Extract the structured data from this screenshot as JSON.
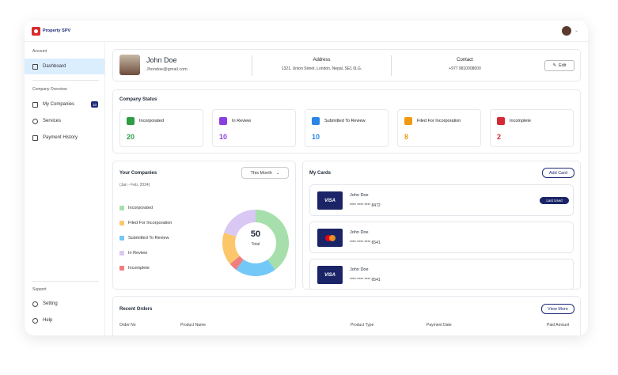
{
  "app": {
    "name": "Property SPV"
  },
  "sidebar": {
    "section_account": "Account",
    "dashboard": "Dashboard",
    "section_company": "Company Overview",
    "my_companies": "My Companies",
    "my_companies_count": "10",
    "services": "Services",
    "payment_history": "Payment History",
    "section_support": "Support",
    "setting": "Setting",
    "help": "Help"
  },
  "profile": {
    "name": "John Doe",
    "email": "Jhondoe@gmail.com",
    "address_label": "Address",
    "address": "1321, Union Street, London, Nepal, SE1 0LG,",
    "contact_label": "Contact",
    "contact": "+977 9810008000",
    "edit_label": "Edit"
  },
  "status": {
    "title": "Company Status",
    "items": [
      {
        "label": "Incorporated",
        "value": "20",
        "color": "#2e9e44"
      },
      {
        "label": "In Review",
        "value": "10",
        "color": "#8a3fe0"
      },
      {
        "label": "Submitted To Review",
        "value": "10",
        "color": "#2b86e6"
      },
      {
        "label": "Filed For Incorporation",
        "value": "8",
        "color": "#f09a12"
      },
      {
        "label": "Incomplete",
        "value": "2",
        "color": "#d42a38"
      }
    ]
  },
  "companies": {
    "title": "Your Companies",
    "period": "(Jan - Feb, 2024)",
    "filter": "This Month",
    "total": "50",
    "total_label": "Total",
    "legend": [
      {
        "label": "Incorporated",
        "color": "#a6dfab"
      },
      {
        "label": "Filed For Incorporation",
        "color": "#fcc66a"
      },
      {
        "label": "Submitted To Review",
        "color": "#72c8f7"
      },
      {
        "label": "In Review",
        "color": "#dac8f4"
      },
      {
        "label": "Incomplete",
        "color": "#f07d7d"
      }
    ]
  },
  "cards": {
    "title": "My Cards",
    "add_label": "Add Card",
    "last_used": "Last Used",
    "items": [
      {
        "brand": "VISA",
        "name": "John Doe",
        "number": "**** **** **** 8472"
      },
      {
        "brand": "mastercard",
        "name": "John Doe",
        "number": "**** **** **** 6541"
      },
      {
        "brand": "VISA",
        "name": "John Doe",
        "number": "**** **** **** 6541"
      }
    ]
  },
  "orders": {
    "title": "Recent Orders",
    "view_more": "View More",
    "columns": [
      "Order No",
      "Product Name",
      "Product Type",
      "Payment Date",
      "Paid Amount"
    ]
  },
  "chart_data": {
    "type": "pie",
    "categories": [
      "Incorporated",
      "Submitted To Review",
      "Incomplete",
      "Filed For Incorporation",
      "In Review"
    ],
    "values": [
      20,
      10,
      2,
      8,
      10
    ]
  }
}
